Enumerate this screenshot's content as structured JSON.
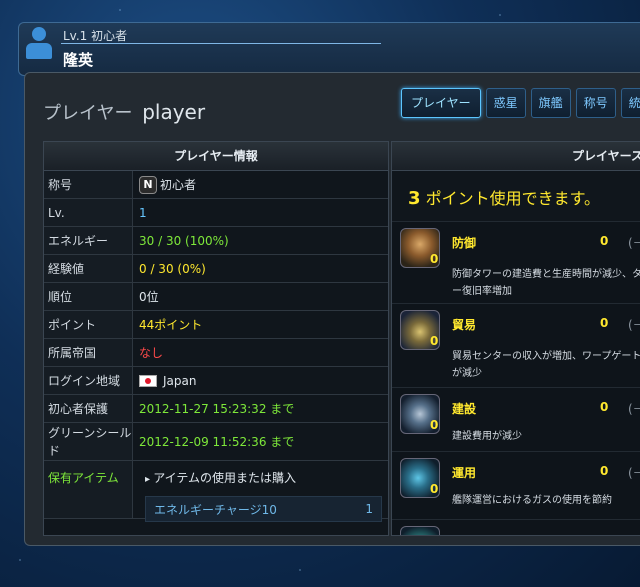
{
  "header": {
    "level": "Lv.1 初心者",
    "player_name": "隆英"
  },
  "panel": {
    "title_prefix": "プレイヤー",
    "title_name": "player",
    "tabs": [
      "プレイヤー",
      "惑星",
      "旗艦",
      "称号",
      "統計"
    ],
    "active_tab": "プレイヤー"
  },
  "info": {
    "heading": "プレイヤー情報",
    "rows": [
      {
        "label": "称号",
        "value": "初心者",
        "icon": "novice-rank-icon"
      },
      {
        "label": "Lv.",
        "value": "1",
        "color": "#66c6ff"
      },
      {
        "label": "エネルギー",
        "value": "30 / 30 (100%)",
        "color": "#7ee83a"
      },
      {
        "label": "経験値",
        "value": "0 / 30 (0%)",
        "color": "#ffe82e"
      },
      {
        "label": "順位",
        "value": "0位"
      },
      {
        "label": "ポイント",
        "value": "44ポイント",
        "color": "#ffe82e"
      },
      {
        "label": "所属帝国",
        "value": "なし",
        "color": "#ff4a4a"
      },
      {
        "label": "ログイン地域",
        "value": "Japan",
        "icon": "japan-flag-icon"
      },
      {
        "label": "初心者保護",
        "value": "2012-11-27 15:23:32 まで",
        "color": "#7ee83a"
      },
      {
        "label": "グリーンシールド",
        "value": "2012-12-09 11:52:36 まで",
        "color": "#7ee83a"
      }
    ],
    "items": {
      "label": "保有アイテム",
      "link": "アイテムの使用または購入",
      "list": [
        {
          "name": "エネルギーチャージ10",
          "count": "1"
        }
      ]
    }
  },
  "skills": {
    "heading": "プレイヤース",
    "points_available": "3",
    "points_text": "ポイント使用できます。",
    "list": [
      {
        "name": "防御",
        "level": "0",
        "points": "0",
        "desc": "防御タワーの建造費と生産時間が減少、タワー復旧率増加",
        "icon": "defense-skill-icon"
      },
      {
        "name": "貿易",
        "level": "0",
        "points": "0",
        "desc": "貿易センターの収入が増加、ワープゲート料が減少",
        "icon": "trade-skill-icon"
      },
      {
        "name": "建設",
        "level": "0",
        "points": "0",
        "desc": "建設費用が減少",
        "icon": "construction-skill-icon"
      },
      {
        "name": "運用",
        "level": "0",
        "points": "0",
        "desc": "艦隊運営におけるガスの使用を節約",
        "icon": "operation-skill-icon"
      }
    ],
    "arrow": "(－"
  }
}
